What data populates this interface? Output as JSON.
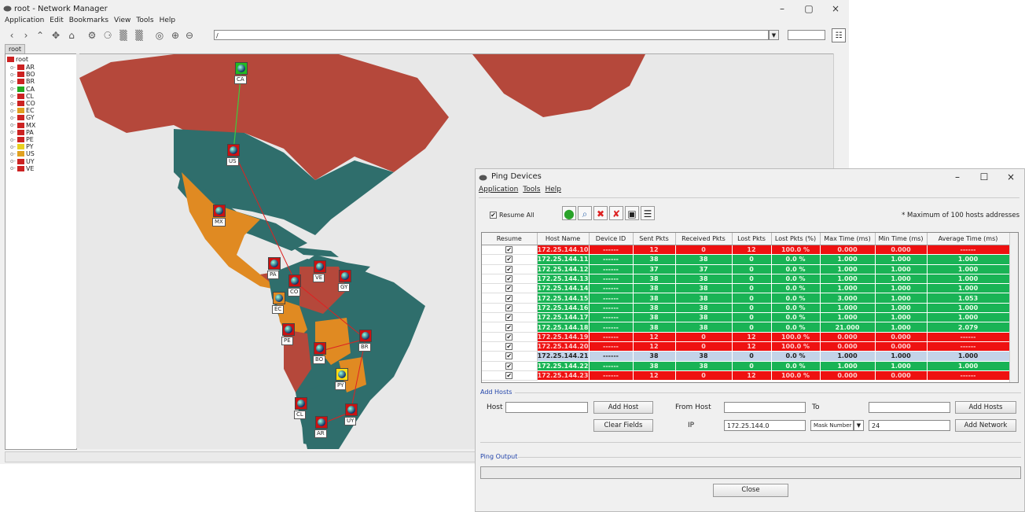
{
  "main": {
    "title": "root - Network Manager",
    "menu": [
      "Application",
      "Edit",
      "Bookmarks",
      "View",
      "Tools",
      "Help"
    ],
    "path_value": "/",
    "tab_label": "root",
    "tree_root": "root",
    "tree_items": [
      "AR",
      "BO",
      "BR",
      "CA",
      "CL",
      "CO",
      "EC",
      "GY",
      "MX",
      "PA",
      "PE",
      "PY",
      "US",
      "UY",
      "VE"
    ],
    "window_controls": [
      "–",
      "▢",
      "×"
    ],
    "map_nodes": [
      "CA",
      "US",
      "MX",
      "PA",
      "VE",
      "GY",
      "CO",
      "EC",
      "PE",
      "BO",
      "BR",
      "PY",
      "CL",
      "AR",
      "UY"
    ]
  },
  "dialog": {
    "title": "Ping Devices",
    "menu": [
      "Application",
      "Tools",
      "Help"
    ],
    "resume_all_label": "Resume All",
    "max_note": "* Maximum of 100 hosts addresses",
    "columns": [
      "Resume",
      "Host Name",
      "Device ID",
      "Sent Pkts",
      "Received Pkts",
      "Lost Pkts",
      "Lost Pkts (%)",
      "Max Time (ms)",
      "Min Time (ms)",
      "Average Time (ms)"
    ],
    "rows": [
      {
        "status": "fail",
        "host": "172.25.144.10",
        "device": "------",
        "sent": "12",
        "recv": "0",
        "lost": "12",
        "pct": "100.0 %",
        "max": "0.000",
        "min": "0.000",
        "avg": "------"
      },
      {
        "status": "ok",
        "host": "172.25.144.11",
        "device": "------",
        "sent": "38",
        "recv": "38",
        "lost": "0",
        "pct": "0.0 %",
        "max": "1.000",
        "min": "1.000",
        "avg": "1.000"
      },
      {
        "status": "ok",
        "host": "172.25.144.12",
        "device": "------",
        "sent": "37",
        "recv": "37",
        "lost": "0",
        "pct": "0.0 %",
        "max": "1.000",
        "min": "1.000",
        "avg": "1.000"
      },
      {
        "status": "ok",
        "host": "172.25.144.13",
        "device": "------",
        "sent": "38",
        "recv": "38",
        "lost": "0",
        "pct": "0.0 %",
        "max": "1.000",
        "min": "1.000",
        "avg": "1.000"
      },
      {
        "status": "ok",
        "host": "172.25.144.14",
        "device": "------",
        "sent": "38",
        "recv": "38",
        "lost": "0",
        "pct": "0.0 %",
        "max": "1.000",
        "min": "1.000",
        "avg": "1.000"
      },
      {
        "status": "ok",
        "host": "172.25.144.15",
        "device": "------",
        "sent": "38",
        "recv": "38",
        "lost": "0",
        "pct": "0.0 %",
        "max": "3.000",
        "min": "1.000",
        "avg": "1.053"
      },
      {
        "status": "ok",
        "host": "172.25.144.16",
        "device": "------",
        "sent": "38",
        "recv": "38",
        "lost": "0",
        "pct": "0.0 %",
        "max": "1.000",
        "min": "1.000",
        "avg": "1.000"
      },
      {
        "status": "ok",
        "host": "172.25.144.17",
        "device": "------",
        "sent": "38",
        "recv": "38",
        "lost": "0",
        "pct": "0.0 %",
        "max": "1.000",
        "min": "1.000",
        "avg": "1.000"
      },
      {
        "status": "ok",
        "host": "172.25.144.18",
        "device": "------",
        "sent": "38",
        "recv": "38",
        "lost": "0",
        "pct": "0.0 %",
        "max": "21.000",
        "min": "1.000",
        "avg": "2.079"
      },
      {
        "status": "fail",
        "host": "172.25.144.19",
        "device": "------",
        "sent": "12",
        "recv": "0",
        "lost": "12",
        "pct": "100.0 %",
        "max": "0.000",
        "min": "0.000",
        "avg": "------"
      },
      {
        "status": "fail",
        "host": "172.25.144.20",
        "device": "------",
        "sent": "12",
        "recv": "0",
        "lost": "12",
        "pct": "100.0 %",
        "max": "0.000",
        "min": "0.000",
        "avg": "------"
      },
      {
        "status": "sel",
        "host": "172.25.144.21",
        "device": "------",
        "sent": "38",
        "recv": "38",
        "lost": "0",
        "pct": "0.0 %",
        "max": "1.000",
        "min": "1.000",
        "avg": "1.000"
      },
      {
        "status": "ok",
        "host": "172.25.144.22",
        "device": "------",
        "sent": "38",
        "recv": "38",
        "lost": "0",
        "pct": "0.0 %",
        "max": "1.000",
        "min": "1.000",
        "avg": "1.000"
      },
      {
        "status": "fail",
        "host": "172.25.144.23",
        "device": "------",
        "sent": "12",
        "recv": "0",
        "lost": "12",
        "pct": "100.0 %",
        "max": "0.000",
        "min": "0.000",
        "avg": "------"
      }
    ],
    "add_hosts_title": "Add Hosts",
    "host_label": "Host",
    "add_host_btn": "Add Host",
    "clear_fields_btn": "Clear Fields",
    "from_host_label": "From Host",
    "to_label": "To",
    "add_hosts_btn": "Add Hosts",
    "ip_label": "IP",
    "ip_value": "172.25.144.0",
    "mask_select": "Mask Number",
    "mask_value": "24",
    "add_network_btn": "Add Network",
    "ping_output_title": "Ping Output",
    "close_btn": "Close",
    "window_controls": [
      "–",
      "☐",
      "×"
    ]
  },
  "colors": {
    "ok": "#19b355",
    "fail": "#ee1111",
    "selected": "#c3d3e8",
    "accent": "#2244aa"
  }
}
